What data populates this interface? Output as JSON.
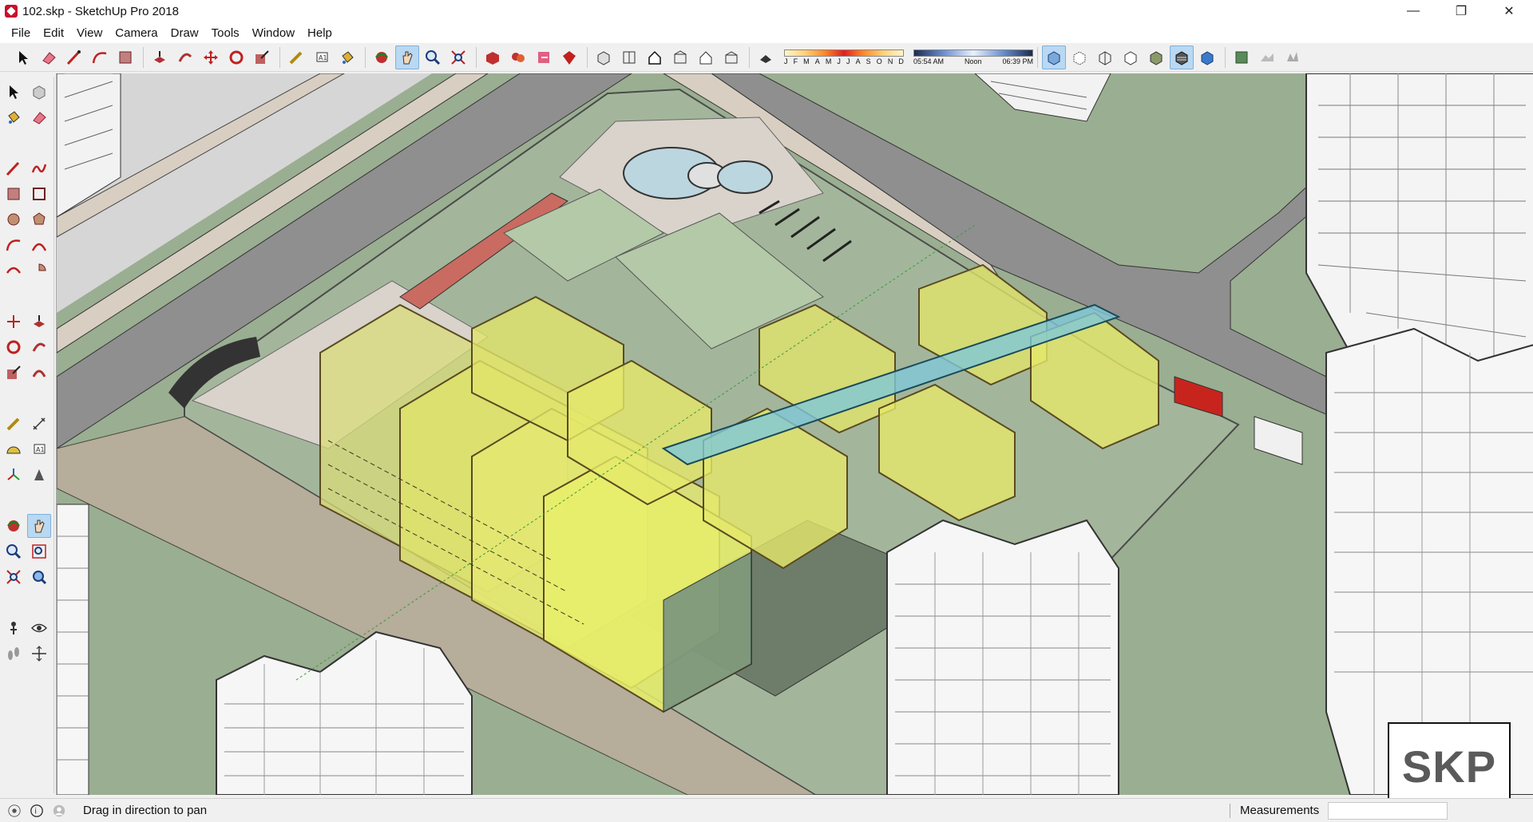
{
  "window": {
    "title": "102.skp - SketchUp Pro 2018",
    "minimize_glyph": "—",
    "restore_glyph": "❐",
    "close_glyph": "✕"
  },
  "menu": {
    "items": [
      "File",
      "Edit",
      "View",
      "Camera",
      "Draw",
      "Tools",
      "Window",
      "Help"
    ]
  },
  "toolbar": {
    "shadow_months": [
      "J",
      "F",
      "M",
      "A",
      "M",
      "J",
      "J",
      "A",
      "S",
      "O",
      "N",
      "D"
    ],
    "time_start": "05:54 AM",
    "time_mid": "Noon",
    "time_end": "06:39 PM",
    "active_tool": "pan-icon"
  },
  "status": {
    "message": "Drag in direction to pan",
    "measurements_label": "Measurements",
    "measurements_value": ""
  },
  "watermark": {
    "text": "SKP"
  },
  "colors": {
    "accent_active": "#b9d8f2",
    "ground": "#9aae91",
    "glass_yellow": "#e8ee6a",
    "road": "#8f8f8f"
  }
}
